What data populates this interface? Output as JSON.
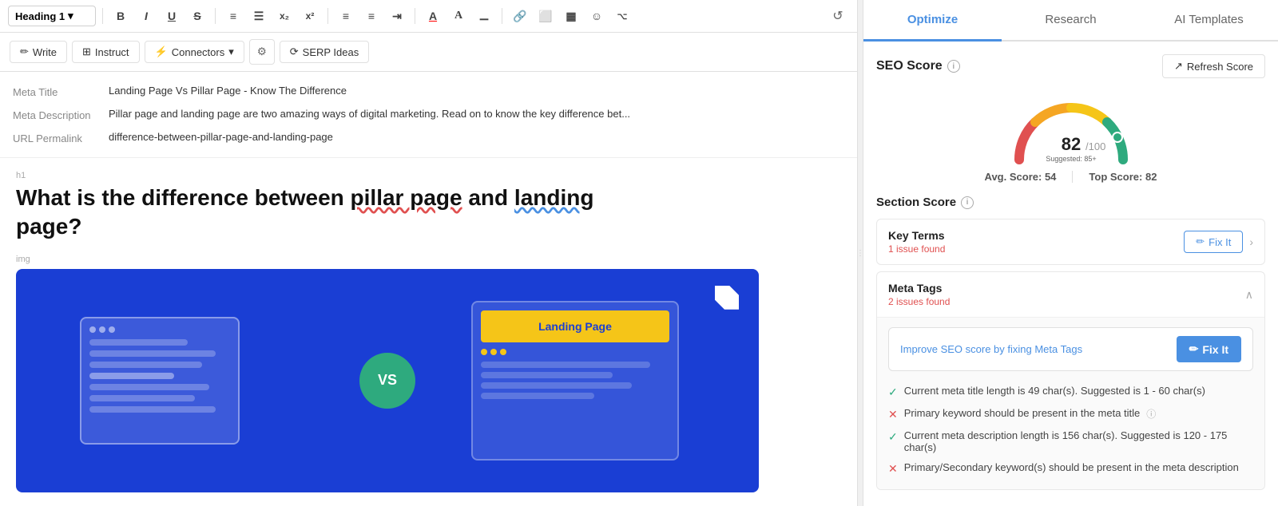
{
  "tabs": {
    "optimize": "Optimize",
    "research": "Research",
    "ai_templates": "AI Templates",
    "active": "optimize"
  },
  "toolbar": {
    "heading_select": "Heading 1",
    "bold": "B",
    "italic": "I",
    "underline": "U",
    "strikethrough": "S",
    "ordered_list": "OL",
    "bullet_list": "UL",
    "subscript": "x₂",
    "superscript": "x²",
    "align_left": "≡",
    "align_center": "≡",
    "indent": "⇥",
    "font_color": "A",
    "clear_format": "A",
    "align": "≡",
    "link": "🔗",
    "image": "🖼",
    "table": "▦",
    "emoji": "☺",
    "code": "</>",
    "history": "↺"
  },
  "secondary_toolbar": {
    "write": "Write",
    "instruct": "Instruct",
    "connectors": "Connectors",
    "settings": "⚙",
    "serp_ideas": "SERP Ideas"
  },
  "meta": {
    "title_label": "Meta Title",
    "title_value": "Landing Page Vs Pillar Page - Know The Difference",
    "description_label": "Meta Description",
    "description_value": "Pillar page and landing page are two amazing ways of digital marketing. Read on to know the key difference bet...",
    "url_label": "URL Permalink",
    "url_value": "difference-between-pillar-page-and-landing-page"
  },
  "article": {
    "heading_tag": "h1",
    "heading": "What is the difference between pillar page and landing page?",
    "heading_underline1": "pillar page",
    "heading_underline2": "landing",
    "image_tag": "img",
    "image_label": "Landing Page",
    "vs_text": "VS"
  },
  "seo": {
    "score_title": "SEO Score",
    "refresh_label": "Refresh Score",
    "score": "82",
    "score_max": "/100",
    "suggested": "Suggested: 85+",
    "avg_label": "Avg. Score:",
    "avg_value": "54",
    "top_label": "Top Score:",
    "top_value": "82",
    "section_score_title": "Section Score"
  },
  "key_terms": {
    "title": "Key Terms",
    "issue": "1 issue found",
    "fix_it": "Fix It"
  },
  "meta_tags": {
    "title": "Meta Tags",
    "issue": "2 issues found",
    "fix_it": "Fix It",
    "improve_text": "Improve SEO score by fixing Meta Tags",
    "checks": [
      {
        "status": "pass",
        "text": "Current meta title length is 49 char(s). Suggested is 1 - 60 char(s)"
      },
      {
        "status": "fail",
        "text": "Primary keyword should be present in the meta title",
        "has_info": true
      },
      {
        "status": "pass",
        "text": "Current meta description length is 156 char(s). Suggested is 120 - 175 char(s)"
      },
      {
        "status": "fail",
        "text": "Primary/Secondary keyword(s) should be present in the meta description"
      }
    ]
  }
}
